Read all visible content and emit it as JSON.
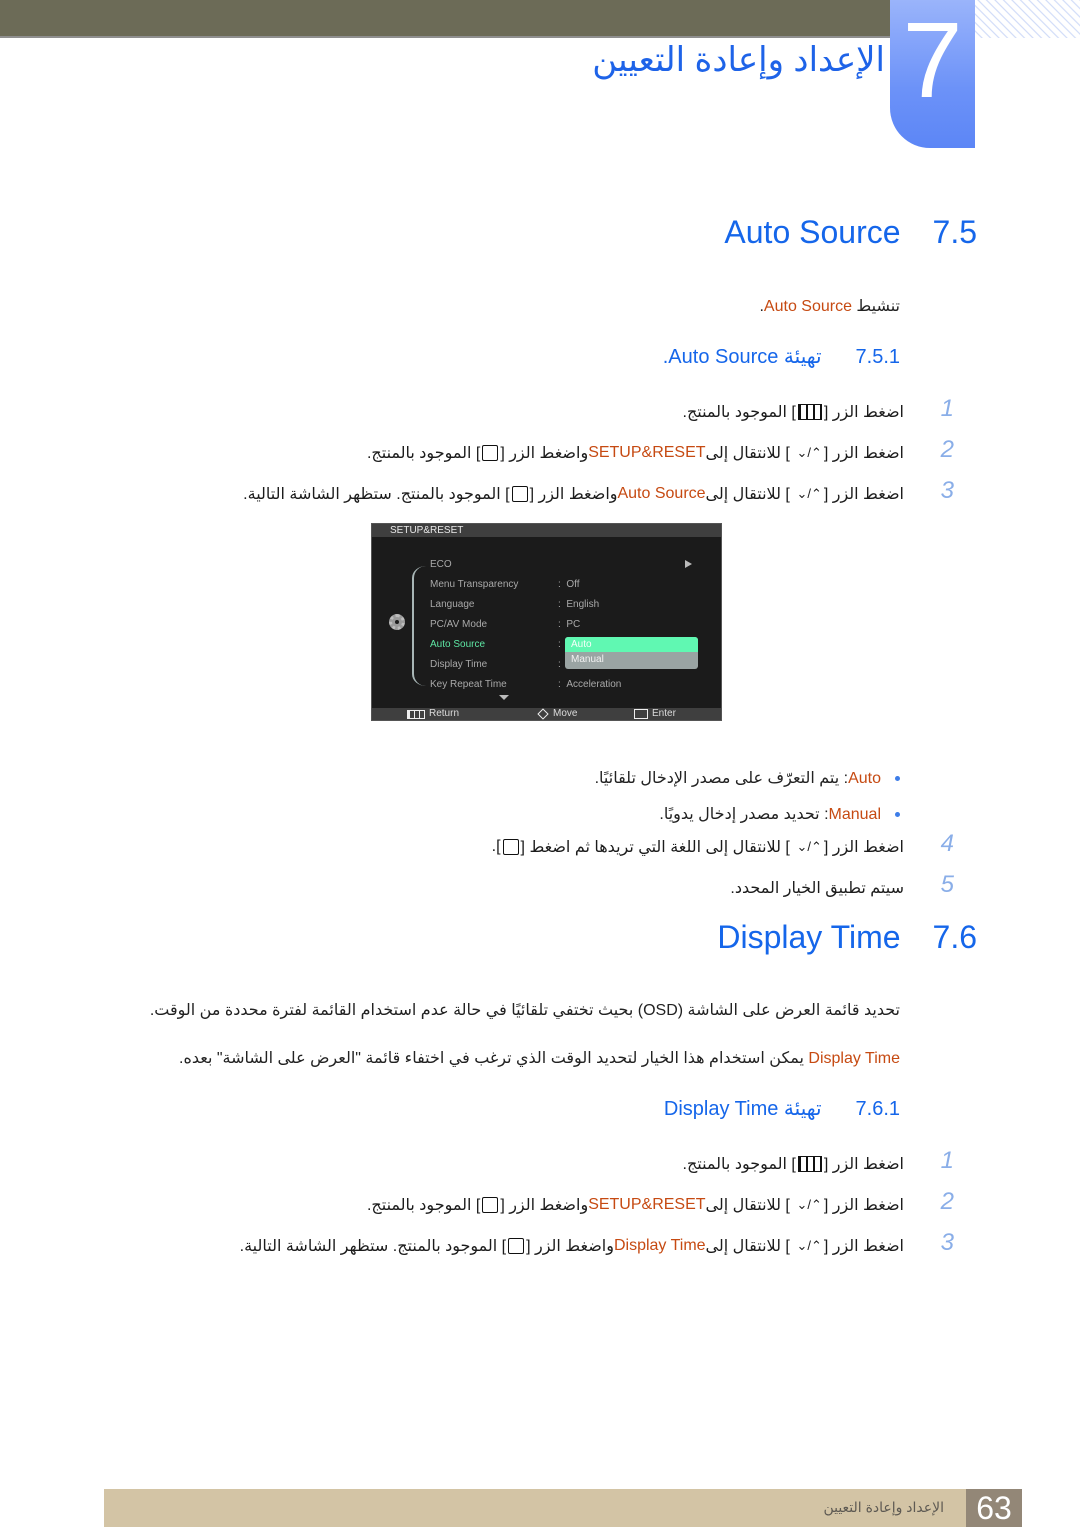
{
  "header": {
    "chapter_number": "7",
    "chapter_title": "الإعداد وإعادة التعيين"
  },
  "section_7_5": {
    "number": "7.5",
    "title": "Auto Source",
    "intro_prefix": "تنشيط ",
    "intro_highlight": "Auto Source",
    "intro_suffix": ".",
    "subsection": {
      "number": "7.5.1",
      "title": "تهيئة Auto Source."
    },
    "steps": [
      {
        "num": "1",
        "parts": [
          "اضغط الزر [",
          "menu-icon",
          "] الموجود بالمنتج."
        ]
      },
      {
        "num": "2",
        "pre": "اضغط الزر [",
        "post1": "] للانتقال إلى ",
        "highlight": "SETUP&RESET",
        "post2": " واضغط الزر [",
        "post3": "] الموجود بالمنتج."
      },
      {
        "num": "3",
        "pre": "اضغط الزر [",
        "post1": "] للانتقال إلى ",
        "highlight": "Auto Source",
        "post2": " واضغط الزر [",
        "post3": "] الموجود بالمنتج. ستظهر الشاشة التالية."
      }
    ],
    "bullets": [
      {
        "term": "Auto",
        "desc": ": يتم التعرّف على مصدر الإدخال تلقائيًا."
      },
      {
        "term": "Manual",
        "desc": ": تحديد مصدر إدخال يدويًا."
      }
    ],
    "step4": {
      "num": "4",
      "pre": "اضغط الزر [",
      "mid": "] للانتقال إلى اللغة التي تريدها ثم اضغط [",
      "post": "]."
    },
    "step5": {
      "num": "5",
      "text": "سيتم تطبيق الخيار المحدد."
    }
  },
  "osd": {
    "title": "SETUP&RESET",
    "items": [
      {
        "label": "ECO",
        "value": ""
      },
      {
        "label": "Menu Transparency",
        "value": "Off"
      },
      {
        "label": "Language",
        "value": "English"
      },
      {
        "label": "PC/AV Mode",
        "value": "PC"
      },
      {
        "label": "Auto Source",
        "value": ""
      },
      {
        "label": "Display Time",
        "value": ""
      },
      {
        "label": "Key Repeat Time",
        "value": "Acceleration"
      }
    ],
    "separator": ":",
    "dropdown_options": [
      "Auto",
      "Manual"
    ],
    "selected_option": "Auto",
    "footer": {
      "return": "Return",
      "move": "Move",
      "enter": "Enter"
    }
  },
  "section_7_6": {
    "number": "7.6",
    "title": "Display Time",
    "para1": "تحديد قائمة العرض على الشاشة (OSD) بحيث تختفي تلقائيًا في حالة عدم استخدام القائمة لفترة محددة من الوقت.",
    "para2_highlight": "Display Time",
    "para2_rest": " يمكن استخدام هذا الخيار لتحديد الوقت الذي ترغب في اختفاء قائمة \"العرض على الشاشة\" بعده.",
    "subsection": {
      "number": "7.6.1",
      "title": "تهيئة Display Time"
    },
    "steps": [
      {
        "num": "1"
      },
      {
        "num": "2",
        "highlight": "SETUP&RESET"
      },
      {
        "num": "3",
        "highlight": "Display Time"
      }
    ]
  },
  "common": {
    "press_btn": "اضغط الزر [",
    "located": "] الموجود بالمنتج.",
    "goto": "] للانتقال إلى ",
    "and_press": " واضغط الزر [",
    "located_next": "] الموجود بالمنتج. ستظهر الشاشة التالية."
  },
  "footer": {
    "title": "الإعداد وإعادة التعيين",
    "page_number": "63"
  },
  "colors": {
    "accent_blue": "#1566ea",
    "highlight_orange": "#c64a12",
    "topbar": "#6c6b57",
    "footer_bar": "#d3c4a5",
    "page_box": "#938777",
    "osd_active": "#5ee7a4"
  }
}
